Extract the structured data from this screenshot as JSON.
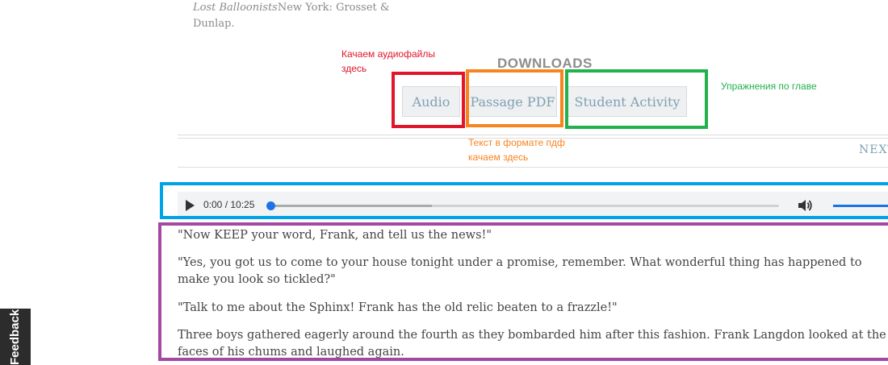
{
  "citation": {
    "book_title": "Lost Balloonists",
    "publisher_text": "New York: Grosset & Dunlap."
  },
  "annotations": {
    "audio_note": "Качаем аудиофайлы здесь",
    "pdf_note": "Текст в формате пдф качаем здесь",
    "activity_note": "Упражнения по главе"
  },
  "downloads": {
    "heading": "DOWNLOADS",
    "audio_label": "Audio",
    "pdf_label": "Passage PDF",
    "activity_label": "Student Activity"
  },
  "nav": {
    "next_label": "NEXT"
  },
  "player": {
    "time_display": "0:00 / 10:25",
    "progress": 0,
    "volume": 1.0
  },
  "passage": {
    "p1": "\"Now KEEP your word, Frank, and tell us the news!\"",
    "p2_line1": "\"Yes, you got us to come to your house tonight under a promise, remember. What wonderful thing has happened to",
    "p2_line2": "make you look so tickled?\"",
    "p3": "\"Talk to me about the Sphinx! Frank has the old relic beaten to a frazzle!\"",
    "p4_line1": "Three boys gathered eagerly around the fourth as they bombarded him after this fashion. Frank Langdon looked at the",
    "p4_line2": "faces of his chums and laughed again."
  },
  "feedback": {
    "label": "Feedback"
  },
  "colors": {
    "red_box": "#e0162b",
    "orange_box": "#f7841e",
    "green_box": "#22b14c",
    "blue_box": "#00a2e8",
    "purple_box": "#a349a4",
    "button_text": "#7fa1b4"
  }
}
